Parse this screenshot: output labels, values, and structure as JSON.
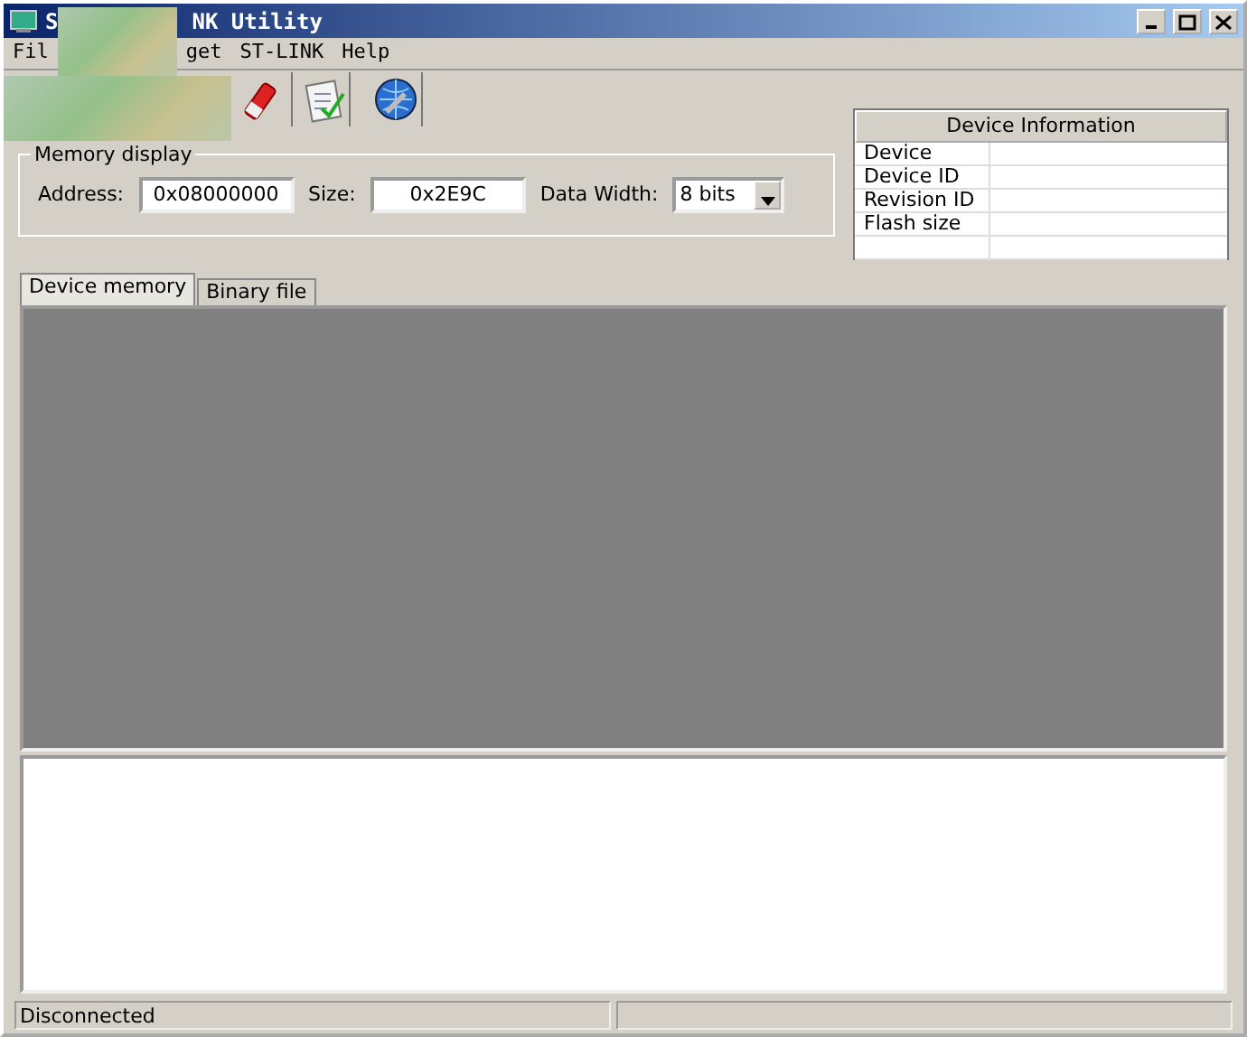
{
  "window": {
    "title_start": "S",
    "title_end": "NK Utility"
  },
  "menu": [
    {
      "label": "Fil"
    },
    {
      "label": "get"
    },
    {
      "label": "ST-LINK"
    },
    {
      "label": "Help"
    }
  ],
  "toolbar": [
    {
      "kind": "eraser"
    },
    {
      "kind": "notepad"
    },
    {
      "kind": "globe"
    }
  ],
  "memory_display": {
    "label": "Memory display",
    "address_label": "Address:",
    "address": "0x08000000",
    "size_label": "Size:",
    "size": "0x2E9C",
    "width_label": "Data Width:",
    "width": "8 bits"
  },
  "device_info": {
    "title": "Device Information",
    "rows": [
      "Device",
      "Device ID",
      "Revision ID",
      "Flash size",
      ""
    ]
  },
  "tabs": [
    {
      "label": "Device memory",
      "selected": true
    },
    {
      "label": "Binary file",
      "selected": false
    }
  ],
  "status_bar": "Disconnected"
}
